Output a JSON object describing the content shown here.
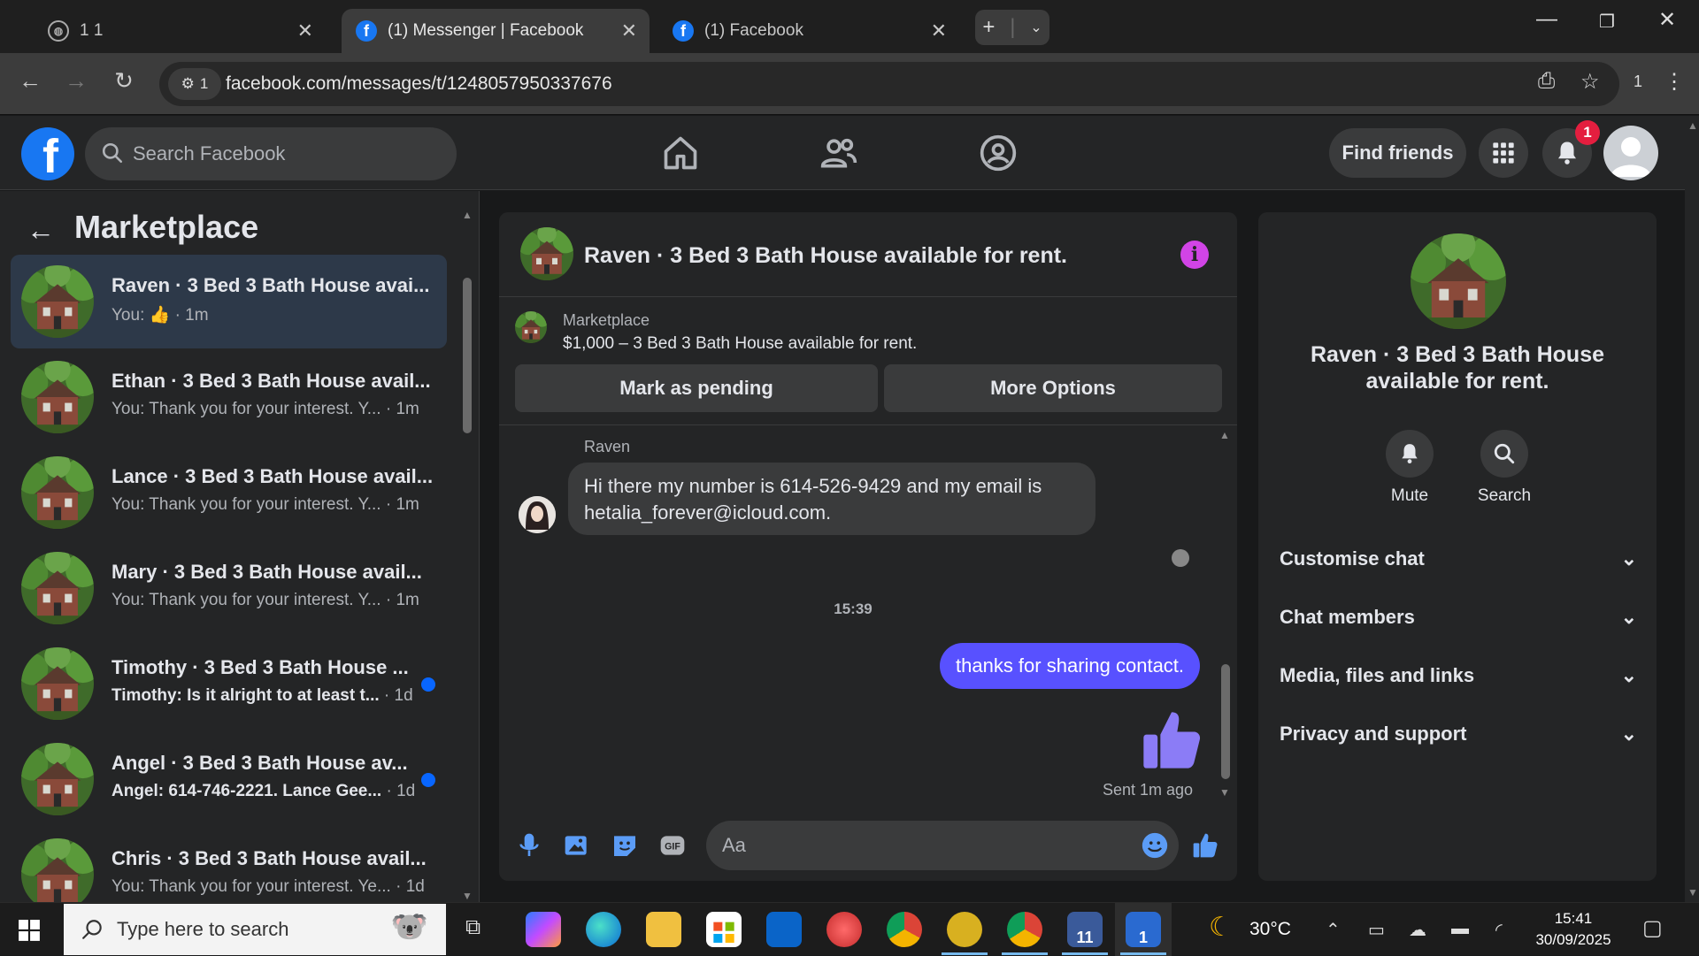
{
  "browser": {
    "tabs": [
      {
        "title": "1 1",
        "active": false
      },
      {
        "title": "(1) Messenger | Facebook",
        "active": true
      },
      {
        "title": "(1) Facebook",
        "active": false
      }
    ],
    "site_info_badge": "1",
    "url": "facebook.com/messages/t/1248057950337676",
    "extension_count": "1"
  },
  "fb_header": {
    "logo": "f",
    "search_placeholder": "Search Facebook",
    "find_friends": "Find friends",
    "notification_count": "1"
  },
  "left_panel": {
    "title": "Marketplace",
    "conversations": [
      {
        "title": "Raven · 3 Bed 3 Bath House avai...",
        "preview": "You:",
        "time": "· 1m",
        "selected": true,
        "unread": false,
        "like": true
      },
      {
        "title": "Ethan · 3 Bed 3 Bath House avail...",
        "preview": "You: Thank you for your interest. Y...",
        "time": "· 1m",
        "selected": false,
        "unread": false
      },
      {
        "title": "Lance · 3 Bed 3 Bath House avail...",
        "preview": "You: Thank you for your interest. Y...",
        "time": "· 1m",
        "selected": false,
        "unread": false
      },
      {
        "title": "Mary · 3 Bed 3 Bath House avail...",
        "preview": "You: Thank you for your interest. Y...",
        "time": "· 1m",
        "selected": false,
        "unread": false
      },
      {
        "title": "Timothy · 3 Bed 3 Bath House ...",
        "preview": "Timothy: Is it alright to at least t...",
        "time": "· 1d",
        "selected": false,
        "unread": true
      },
      {
        "title": "Angel · 3 Bed 3 Bath House av...",
        "preview": "Angel: 614-746-2221. Lance Gee...",
        "time": "· 1d",
        "selected": false,
        "unread": true
      },
      {
        "title": "Chris · 3 Bed 3 Bath House avail...",
        "preview": "You: Thank you for your interest. Ye...",
        "time": "· 1d",
        "selected": false,
        "unread": false
      }
    ]
  },
  "chat": {
    "title": "Raven · 3 Bed 3 Bath House available for rent.",
    "marketplace_label": "Marketplace",
    "listing": "$1,000 – 3 Bed 3 Bath House available for rent.",
    "mark_pending": "Mark as pending",
    "more_options": "More Options",
    "sender": "Raven",
    "incoming_message": "Hi there my number is 614-526-9429 and my email is hetalia_forever@icloud.com.",
    "timestamp": "15:39",
    "outgoing_message": "thanks for sharing contact.",
    "sent_status": "Sent 1m ago",
    "composer_placeholder": "Aa"
  },
  "right_panel": {
    "title": "Raven · 3 Bed 3 Bath House available for rent.",
    "mute": "Mute",
    "search": "Search",
    "sections": [
      "Customise chat",
      "Chat members",
      "Media, files and links",
      "Privacy and support"
    ]
  },
  "taskbar": {
    "search_placeholder": "Type here to search",
    "temperature": "30°C",
    "time": "15:41",
    "date": "30/09/2025",
    "badge_11": "11",
    "badge_1": "1"
  },
  "colors": {
    "fb_blue": "#1877f2",
    "outgoing_bubble": "#5851ff",
    "info_purple": "#d144e6",
    "like_purple": "#8b7cf6",
    "unread_dot": "#0866ff",
    "notif_red": "#e41e3f"
  }
}
